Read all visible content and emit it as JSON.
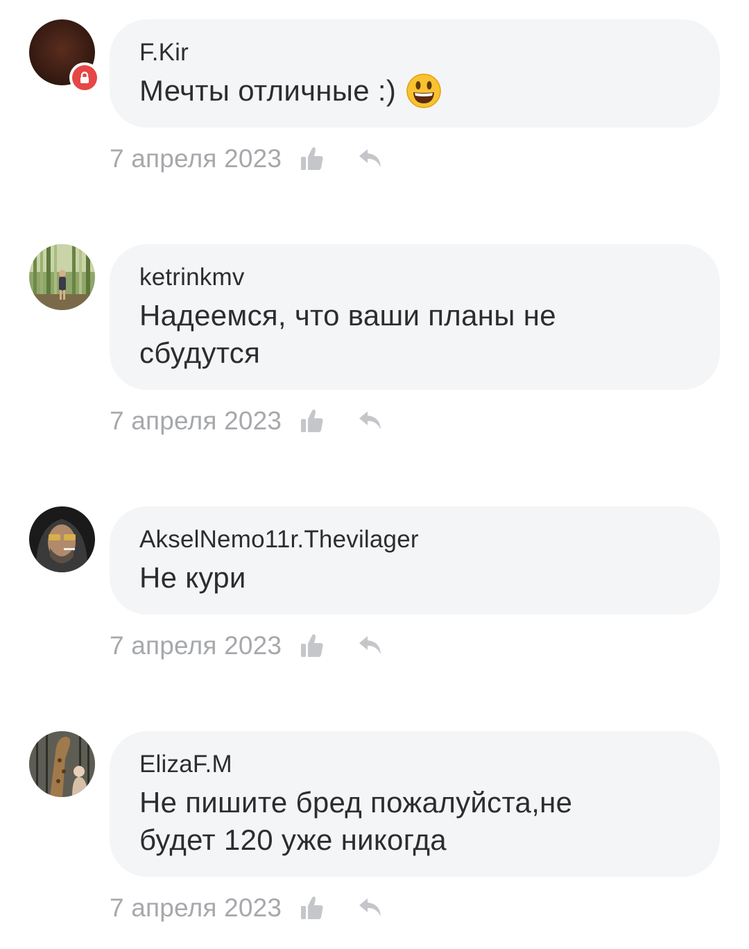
{
  "comments": [
    {
      "author": "F.Kir",
      "text": "Мечты отличные :)",
      "emoji": "smiley-emoji",
      "date": "7 апреля 2023",
      "avatar": "brown-blank-avatar",
      "locked": true
    },
    {
      "author": "ketrinkmv",
      "text": "Надеемся, что ваши планы не сбудутся",
      "date": "7 апреля 2023",
      "avatar": "bamboo-photo-avatar"
    },
    {
      "author": "AkselNemo11r.Thevilager",
      "text": "Не кури",
      "date": "7 апреля 2023",
      "avatar": "hooded-man-avatar"
    },
    {
      "author": "ElizaF.M",
      "text": "Не пишите бред пожалуйста,не будет 120 уже никогда",
      "date": "7 апреля 2023",
      "avatar": "giraffe-photo-avatar"
    }
  ],
  "colors": {
    "bubble": "#f4f5f7",
    "text": "#2c2d2e",
    "meta": "#a6a8ac",
    "lock_badge": "#e64646"
  },
  "icons": {
    "like": "thumbs-up-icon",
    "reply": "reply-arrow-icon",
    "lock": "lock-icon"
  }
}
